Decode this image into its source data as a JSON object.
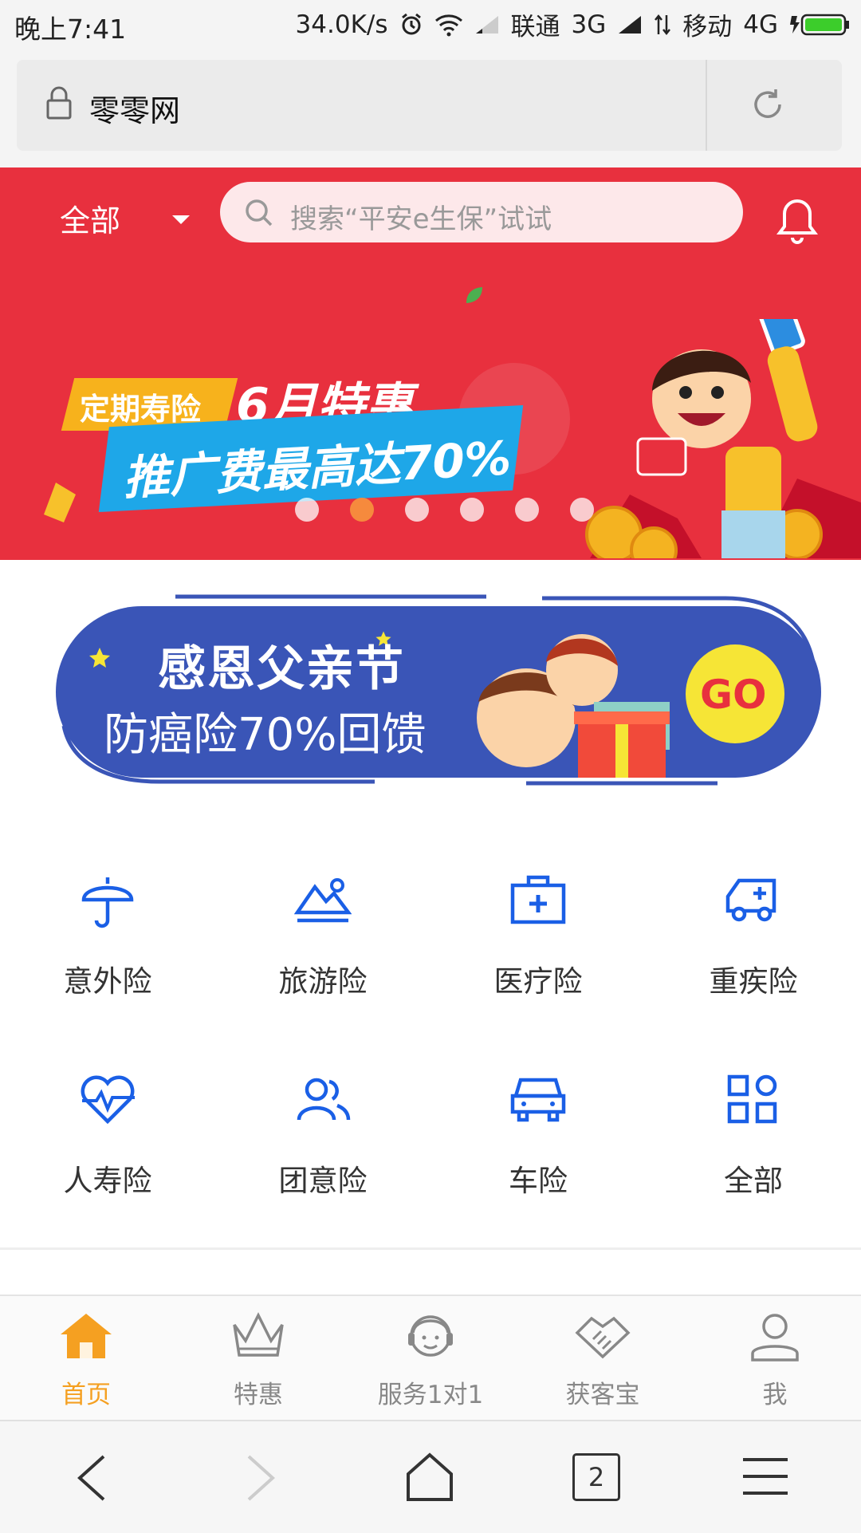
{
  "status_bar": {
    "time": "晚上7:41",
    "speed": "34.0K/s",
    "carrier1": "联通",
    "net1": "3G",
    "carrier2": "移动",
    "net2": "4G"
  },
  "browser": {
    "url_title": "零零网"
  },
  "header": {
    "category": "全部",
    "search_placeholder": "搜索“平安e生保”试试"
  },
  "hero_banner": {
    "tag": "定期寿险",
    "title": "6月特惠",
    "subtitle": "推广费最高达70%",
    "active_dot": 2,
    "dot_count": 6
  },
  "promo_banner": {
    "line1": "感恩父亲节",
    "line2": "防癌险70%回馈",
    "cta": "GO"
  },
  "categories": [
    {
      "label": "意外险",
      "icon": "umbrella-icon"
    },
    {
      "label": "旅游险",
      "icon": "mountain-icon"
    },
    {
      "label": "医疗险",
      "icon": "medical-kit-icon"
    },
    {
      "label": "重疾险",
      "icon": "ambulance-icon"
    },
    {
      "label": "人寿险",
      "icon": "heart-pulse-icon"
    },
    {
      "label": "团意险",
      "icon": "group-icon"
    },
    {
      "label": "车险",
      "icon": "car-icon"
    },
    {
      "label": "全部",
      "icon": "grid-icon"
    }
  ],
  "tabs": [
    {
      "label": "首页",
      "icon": "home-icon",
      "active": true
    },
    {
      "label": "特惠",
      "icon": "crown-icon",
      "active": false
    },
    {
      "label": "服务1对1",
      "icon": "agent-icon",
      "active": false
    },
    {
      "label": "获客宝",
      "icon": "handshake-icon",
      "active": false
    },
    {
      "label": "我",
      "icon": "user-icon",
      "active": false
    }
  ],
  "nav": {
    "tab_count": "2"
  },
  "colors": {
    "brand_red": "#e8303e",
    "icon_blue": "#1a5fe6",
    "active_orange": "#f5a021",
    "promo_blue": "#3a55b7"
  }
}
